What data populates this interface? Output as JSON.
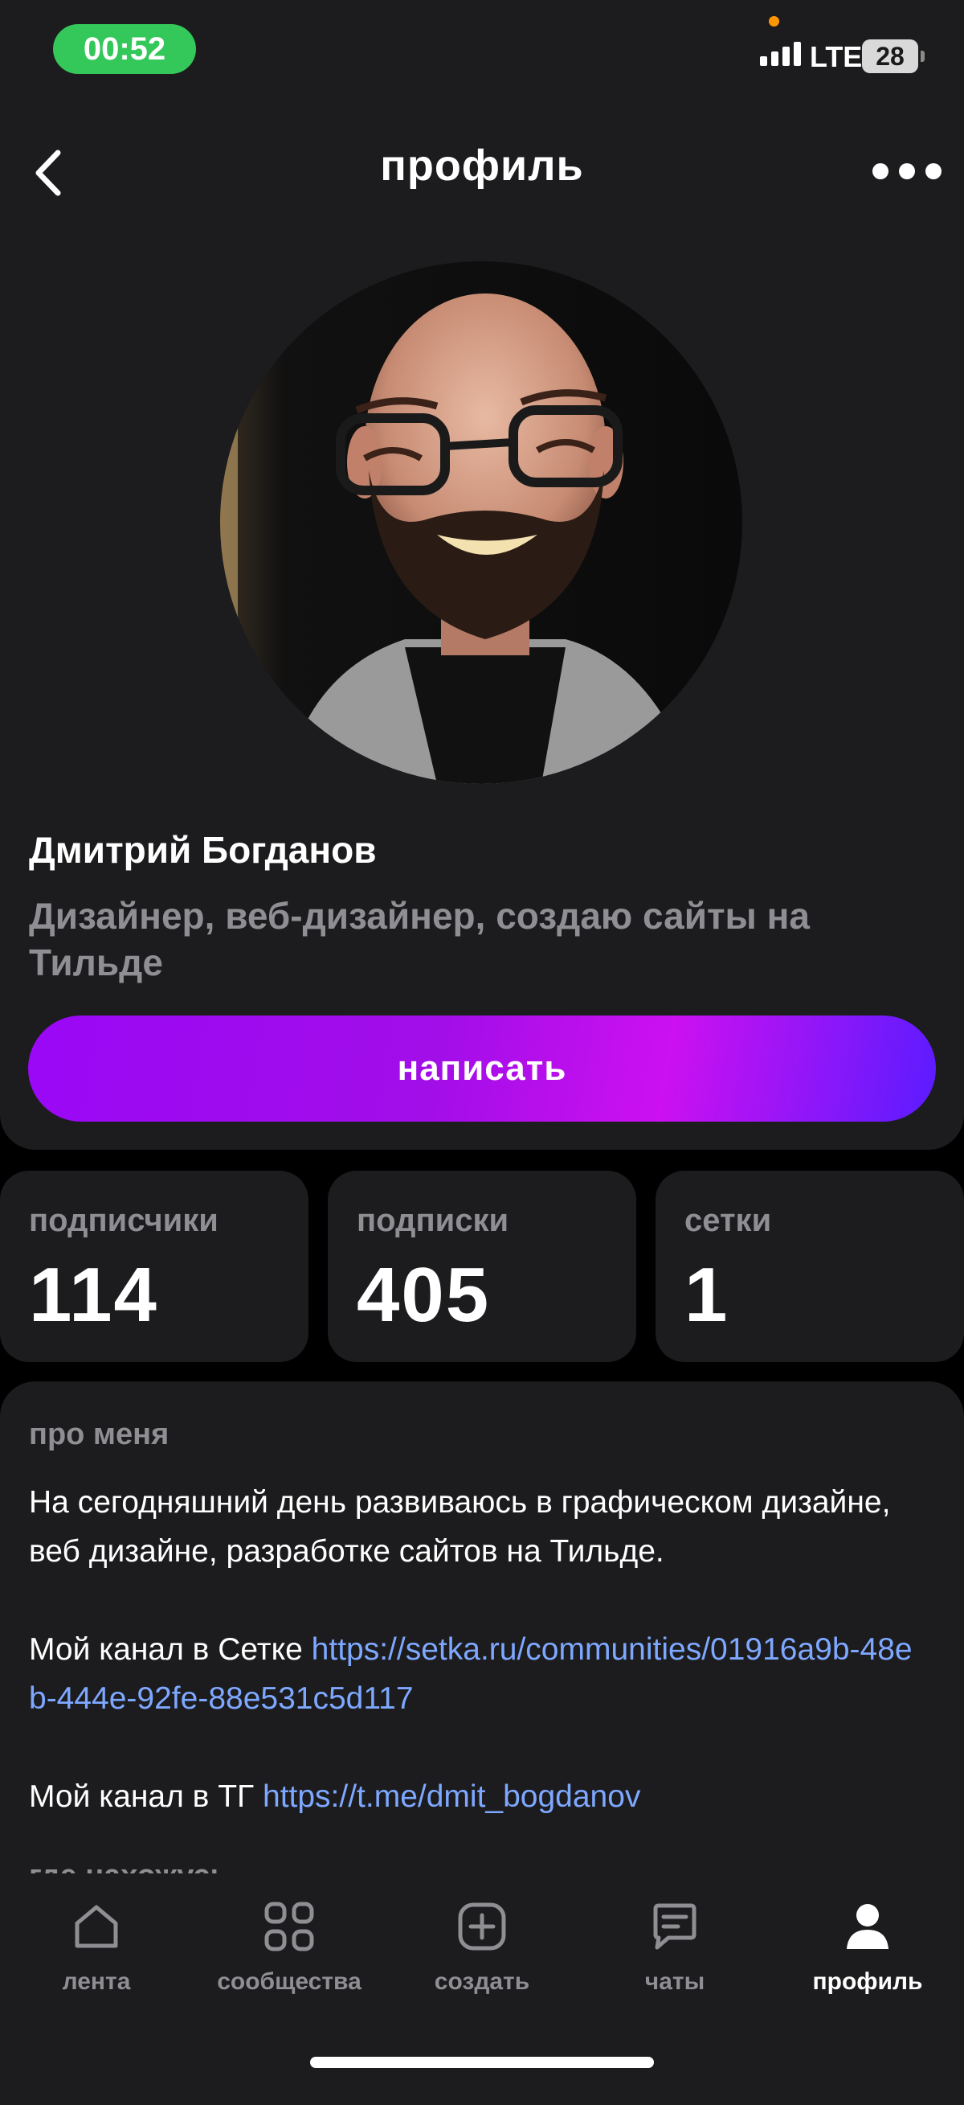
{
  "status_bar": {
    "time": "00:52",
    "network": "LTE",
    "battery": "28"
  },
  "header": {
    "title": "профиль",
    "back_icon": "chevron-left-icon",
    "more_icon": "more-dots-icon"
  },
  "profile": {
    "name": "Дмитрий Богданов",
    "bio": "Дизайнер, веб-дизайнер, создаю сайты на Тильде",
    "write_button": "написать"
  },
  "stats": [
    {
      "label": "подписчики",
      "value": "114"
    },
    {
      "label": "подписки",
      "value": "405"
    },
    {
      "label": "сетки",
      "value": "1"
    }
  ],
  "about": {
    "title": "про меня",
    "paragraph1": "На сегодняшний день развиваюсь в графическом дизайне, веб дизайне, разработке сайтов на Тильде.",
    "setka_prefix": "Мой канал в Сетке ",
    "setka_link": "https://setka.ru/communities/01916a9b-48eb-444e-92fe-88e531c5d117",
    "tg_prefix": "Мой канал в ТГ ",
    "tg_link": "https://t.me/dmit_bogdanov",
    "location_title": "где нахожусь"
  },
  "nav": [
    {
      "label": "лента",
      "icon": "home-icon"
    },
    {
      "label": "сообщества",
      "icon": "grid-icon"
    },
    {
      "label": "создать",
      "icon": "plus-square-icon"
    },
    {
      "label": "чаты",
      "icon": "chat-icon"
    },
    {
      "label": "профиль",
      "icon": "person-icon",
      "active": true
    }
  ],
  "colors": {
    "accent_gradient_start": "#9a08f6",
    "accent_gradient_end": "#5a1cff",
    "link": "#7ea8ff",
    "card": "#1c1c1e",
    "status_pill": "#34c759"
  }
}
